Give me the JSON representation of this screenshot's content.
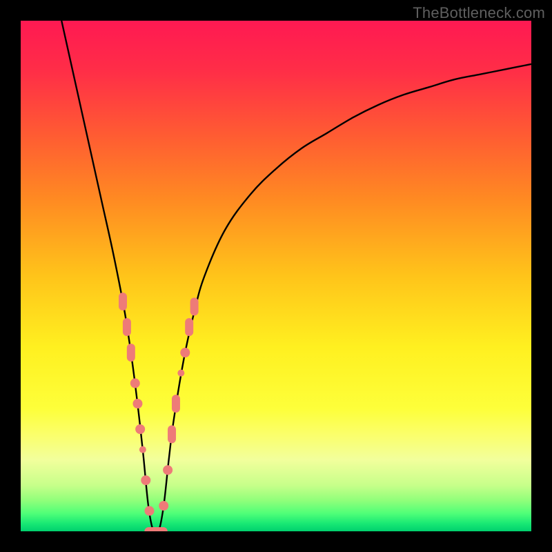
{
  "watermark": "TheBottleneck.com",
  "colors": {
    "frame": "#000000",
    "curve": "#000000",
    "marker_fill": "#ee7b78",
    "marker_stroke": "#ee7b78"
  },
  "gradient_stops": [
    {
      "offset": 0.0,
      "color": "#ff1952"
    },
    {
      "offset": 0.1,
      "color": "#ff2e47"
    },
    {
      "offset": 0.22,
      "color": "#ff5a33"
    },
    {
      "offset": 0.35,
      "color": "#ff8a22"
    },
    {
      "offset": 0.5,
      "color": "#ffc41a"
    },
    {
      "offset": 0.64,
      "color": "#fff020"
    },
    {
      "offset": 0.76,
      "color": "#fdff3a"
    },
    {
      "offset": 0.81,
      "color": "#fbff6a"
    },
    {
      "offset": 0.86,
      "color": "#f2ff9c"
    },
    {
      "offset": 0.91,
      "color": "#c7ff8a"
    },
    {
      "offset": 0.94,
      "color": "#8fff7a"
    },
    {
      "offset": 0.965,
      "color": "#4fff78"
    },
    {
      "offset": 0.985,
      "color": "#18e874"
    },
    {
      "offset": 1.0,
      "color": "#00d06e"
    }
  ],
  "chart_data": {
    "type": "line",
    "title": "",
    "xlabel": "",
    "ylabel": "",
    "xlim": [
      0,
      100
    ],
    "ylim": [
      0,
      100
    ],
    "series": [
      {
        "name": "bottleneck-curve",
        "x": [
          8,
          10,
          12,
          14,
          16,
          18,
          20,
          21,
          22,
          23,
          24,
          25,
          26,
          27,
          28,
          29,
          30,
          32,
          34,
          36,
          40,
          45,
          50,
          55,
          60,
          65,
          70,
          75,
          80,
          85,
          90,
          95,
          100
        ],
        "y": [
          100,
          91,
          82,
          73,
          64,
          55,
          45,
          39,
          32,
          24,
          15,
          5,
          0,
          0,
          5,
          14,
          22,
          34,
          43,
          50,
          59,
          66,
          71,
          75,
          78,
          81,
          83.5,
          85.5,
          87,
          88.5,
          89.5,
          90.5,
          91.5
        ]
      }
    ],
    "markers": [
      {
        "x": 20.0,
        "y": 45,
        "shape": "pill-v"
      },
      {
        "x": 20.8,
        "y": 40,
        "shape": "pill-v"
      },
      {
        "x": 21.6,
        "y": 35,
        "shape": "pill-v"
      },
      {
        "x": 22.4,
        "y": 29,
        "shape": "round"
      },
      {
        "x": 22.9,
        "y": 25,
        "shape": "round"
      },
      {
        "x": 23.4,
        "y": 20,
        "shape": "round"
      },
      {
        "x": 23.9,
        "y": 16,
        "shape": "round-sm"
      },
      {
        "x": 24.5,
        "y": 10,
        "shape": "round"
      },
      {
        "x": 25.2,
        "y": 4,
        "shape": "round"
      },
      {
        "x": 26.0,
        "y": 0,
        "shape": "pill-h"
      },
      {
        "x": 27.0,
        "y": 0,
        "shape": "pill-h"
      },
      {
        "x": 28.0,
        "y": 5,
        "shape": "round"
      },
      {
        "x": 28.8,
        "y": 12,
        "shape": "round"
      },
      {
        "x": 29.6,
        "y": 19,
        "shape": "pill-v"
      },
      {
        "x": 30.4,
        "y": 25,
        "shape": "pill-v"
      },
      {
        "x": 31.4,
        "y": 31,
        "shape": "round-sm"
      },
      {
        "x": 32.2,
        "y": 35,
        "shape": "round"
      },
      {
        "x": 33.0,
        "y": 40,
        "shape": "pill-v"
      },
      {
        "x": 34.0,
        "y": 44,
        "shape": "pill-v"
      }
    ]
  }
}
